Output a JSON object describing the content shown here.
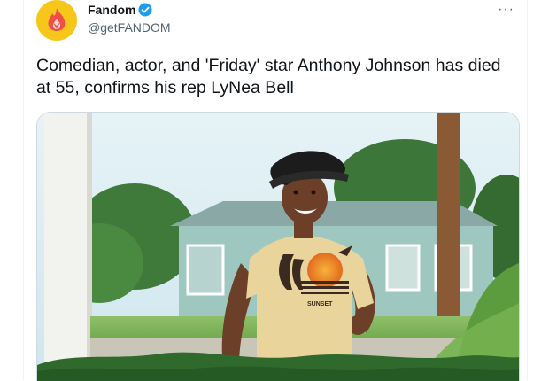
{
  "tweet": {
    "display_name": "Fandom",
    "handle": "@getFANDOM",
    "more_label": "···",
    "text": "Comedian, actor, and 'Friday' star Anthony Johnson has died at 55, confirms his rep LyNea Bell",
    "avatar_icon": "fandom-flame-logo",
    "verified_icon": "verified-badge-icon"
  },
  "media": {
    "alt": "photo",
    "shirt_print": "SUNSET"
  },
  "colors": {
    "avatar_bg": "#f7c61b",
    "verified": "#1d9bf0",
    "text": "#0f1419",
    "secondary": "#536471"
  }
}
